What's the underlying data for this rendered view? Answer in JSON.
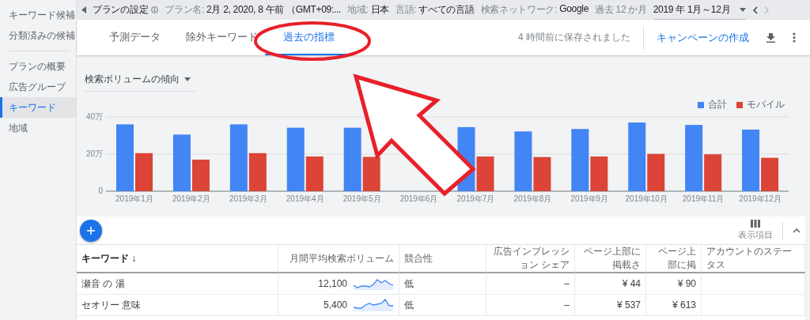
{
  "sidebar": {
    "sections": [
      {
        "items": [
          {
            "label": "キーワード候補",
            "selected": false
          },
          {
            "label": "分類済みの候補",
            "selected": false
          }
        ]
      },
      {
        "items": [
          {
            "label": "プランの概要",
            "selected": false
          },
          {
            "label": "広告グループ",
            "selected": false
          },
          {
            "label": "キーワード",
            "selected": true
          },
          {
            "label": "地域",
            "selected": false
          }
        ]
      }
    ]
  },
  "settings_bar": {
    "title": "プランの設定",
    "fields": [
      {
        "label": "プラン名:",
        "value": "2月 2, 2020, 8 午前 （GMT+09:..."
      },
      {
        "label": "地域:",
        "value": "日本"
      },
      {
        "label": "言語:",
        "value": "すべての言語"
      },
      {
        "label": "検索ネットワーク:",
        "value": "Google"
      }
    ],
    "period_label": "過去 12 か月",
    "period": "2019 年 1月～12月"
  },
  "tabs": [
    {
      "label": "予測データ",
      "selected": false
    },
    {
      "label": "除外キーワード",
      "selected": false
    },
    {
      "label": "過去の指標",
      "selected": true
    }
  ],
  "saved_status": "4 時間前に保存されました",
  "create_campaign": "キャンペーンの作成",
  "trend": {
    "title": "検索ボリュームの傾向",
    "chart_data": {
      "type": "bar",
      "categories": [
        "2019年1月",
        "2019年2月",
        "2019年3月",
        "2019年4月",
        "2019年5月",
        "2019年6月",
        "2019年7月",
        "2019年8月",
        "2019年9月",
        "2019年10月",
        "2019年11月",
        "2019年12月"
      ],
      "series": [
        {
          "name": "合計",
          "color": "#4285f4",
          "values": [
            36,
            30.5,
            36,
            34.2,
            34.2,
            null,
            34.5,
            32.2,
            33.5,
            37,
            35.7,
            33.2
          ]
        },
        {
          "name": "モバイル",
          "color": "#db4437",
          "values": [
            20.5,
            17,
            20.5,
            18.7,
            18.5,
            null,
            18.7,
            18.4,
            18.7,
            20.1,
            19.9,
            18
          ]
        }
      ],
      "ylim": [
        0,
        40
      ],
      "yticks": [
        {
          "value": 0,
          "label": "0"
        },
        {
          "value": 20,
          "label": "20万"
        },
        {
          "value": 40,
          "label": "40万"
        }
      ]
    }
  },
  "table": {
    "columns_button": "表示項目",
    "columns": [
      {
        "label": "キーワード ↓"
      },
      {
        "label": "月間平均検索ボリューム"
      },
      {
        "label": "競合性"
      },
      {
        "label": "広告インプレッション シェア"
      },
      {
        "label": "ページ上部に掲載さ"
      },
      {
        "label": "ページ上部に掲"
      },
      {
        "label": "アカウントのステータス"
      }
    ],
    "rows": [
      {
        "keyword": "瀬音 の 湯",
        "volume": "12,100",
        "competition": "低",
        "impression_share": "–",
        "top_low": "¥ 44",
        "top_high": "¥ 90"
      },
      {
        "keyword": "セオリー 意味",
        "volume": "5,400",
        "competition": "低",
        "impression_share": "–",
        "top_low": "¥ 537",
        "top_high": "¥ 613"
      }
    ]
  }
}
